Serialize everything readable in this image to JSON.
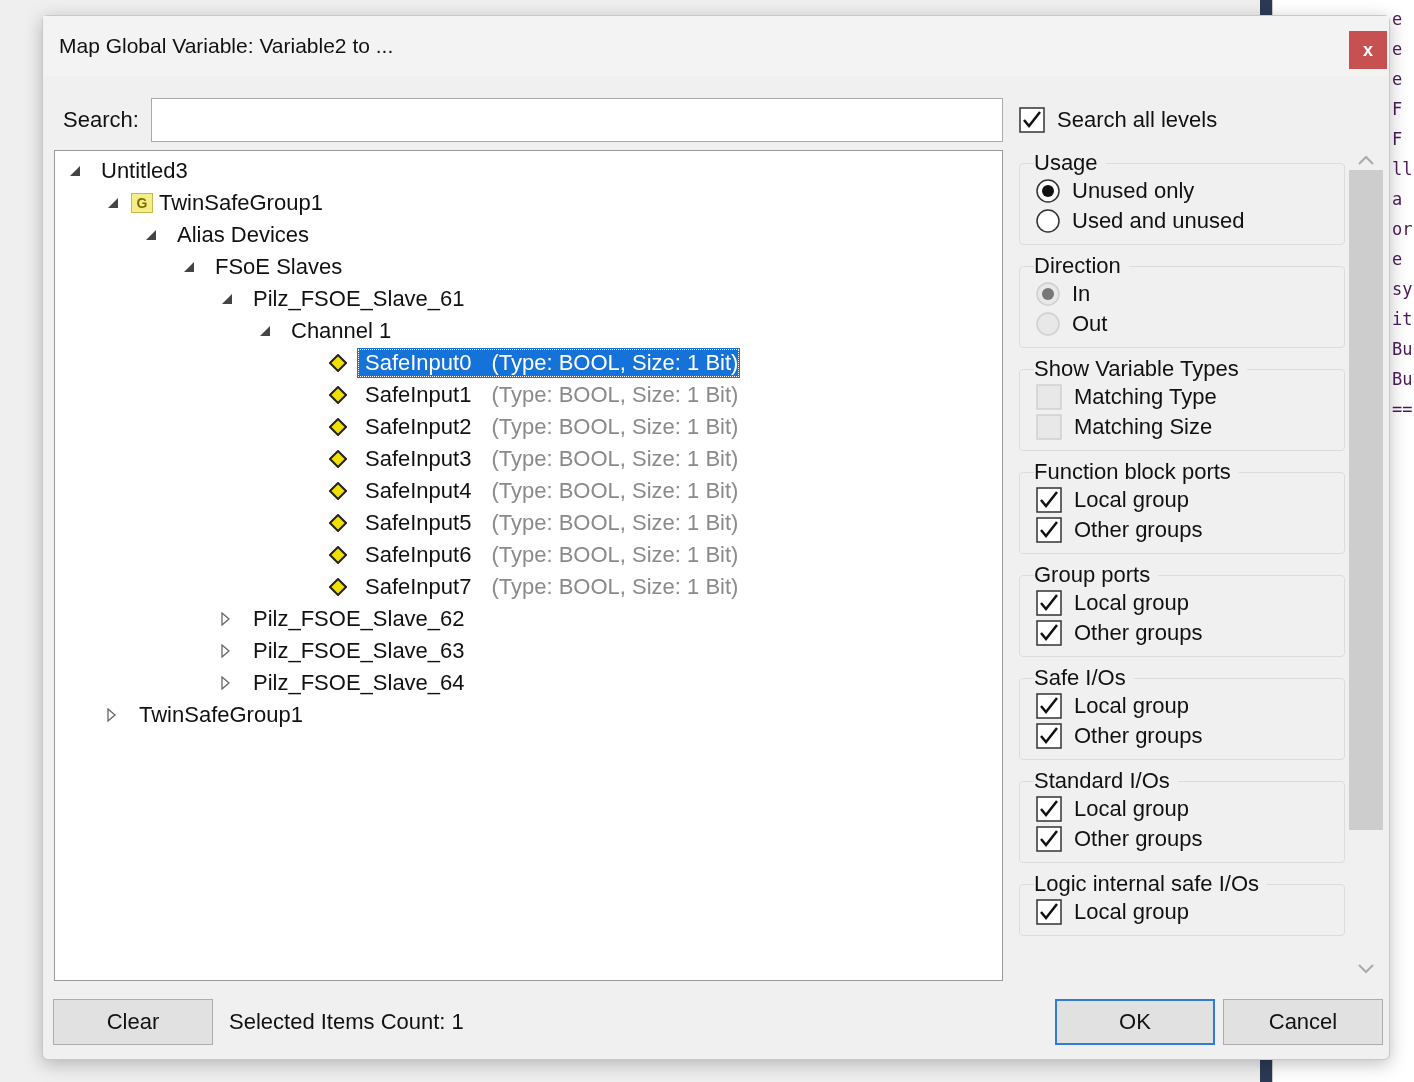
{
  "background_editor": {
    "lines": [
      "e",
      "e",
      "e",
      "F",
      "F",
      "ll",
      "a",
      "or",
      "e",
      "sy",
      "it",
      "Bu",
      "Bu",
      "=="
    ]
  },
  "dialog": {
    "title": "Map Global Variable: Variable2 to ...",
    "close_label": "x"
  },
  "search": {
    "label": "Search:"
  },
  "search_all_levels": {
    "label": "Search all levels",
    "checked": true
  },
  "tree": [
    {
      "label": "Untitled3",
      "kind": "folder",
      "expanded": true,
      "children": [
        {
          "label": "TwinSafeGroup1",
          "kind": "group",
          "badge": "G",
          "expanded": true,
          "children": [
            {
              "label": "Alias Devices",
              "kind": "folder",
              "expanded": true,
              "children": [
                {
                  "label": "FSoE Slaves",
                  "kind": "folder",
                  "expanded": true,
                  "children": [
                    {
                      "label": "Pilz_FSOE_Slave_61",
                      "kind": "folder",
                      "expanded": true,
                      "children": [
                        {
                          "label": "Channel 1",
                          "kind": "folder",
                          "expanded": true,
                          "children": [
                            {
                              "label": "SafeInput0",
                              "kind": "variable",
                              "type_info": "(Type: BOOL, Size: 1 Bit)",
                              "selected": true
                            },
                            {
                              "label": "SafeInput1",
                              "kind": "variable",
                              "type_info": "(Type: BOOL, Size: 1 Bit)",
                              "selected": false
                            },
                            {
                              "label": "SafeInput2",
                              "kind": "variable",
                              "type_info": "(Type: BOOL, Size: 1 Bit)",
                              "selected": false
                            },
                            {
                              "label": "SafeInput3",
                              "kind": "variable",
                              "type_info": "(Type: BOOL, Size: 1 Bit)",
                              "selected": false
                            },
                            {
                              "label": "SafeInput4",
                              "kind": "variable",
                              "type_info": "(Type: BOOL, Size: 1 Bit)",
                              "selected": false
                            },
                            {
                              "label": "SafeInput5",
                              "kind": "variable",
                              "type_info": "(Type: BOOL, Size: 1 Bit)",
                              "selected": false
                            },
                            {
                              "label": "SafeInput6",
                              "kind": "variable",
                              "type_info": "(Type: BOOL, Size: 1 Bit)",
                              "selected": false
                            },
                            {
                              "label": "SafeInput7",
                              "kind": "variable",
                              "type_info": "(Type: BOOL, Size: 1 Bit)",
                              "selected": false
                            }
                          ]
                        }
                      ]
                    },
                    {
                      "label": "Pilz_FSOE_Slave_62",
                      "kind": "folder",
                      "expanded": false
                    },
                    {
                      "label": "Pilz_FSOE_Slave_63",
                      "kind": "folder",
                      "expanded": false
                    },
                    {
                      "label": "Pilz_FSOE_Slave_64",
                      "kind": "folder",
                      "expanded": false
                    }
                  ]
                }
              ]
            }
          ]
        },
        {
          "label": "TwinSafeGroup1",
          "kind": "folder",
          "expanded": false
        }
      ]
    }
  ],
  "filters": [
    {
      "title": "Usage",
      "kind": "radio",
      "options": [
        {
          "label": "Unused only",
          "selected": true,
          "disabled": false
        },
        {
          "label": "Used and unused",
          "selected": false,
          "disabled": false
        }
      ]
    },
    {
      "title": "Direction",
      "kind": "radio",
      "options": [
        {
          "label": "In",
          "selected": true,
          "disabled": true
        },
        {
          "label": "Out",
          "selected": false,
          "disabled": true
        }
      ]
    },
    {
      "title": "Show Variable Types",
      "kind": "checkbox",
      "options": [
        {
          "label": "Matching Type",
          "checked": false,
          "disabled": true
        },
        {
          "label": "Matching Size",
          "checked": false,
          "disabled": true
        }
      ]
    },
    {
      "title": "Function block ports",
      "kind": "checkbox",
      "options": [
        {
          "label": "Local group",
          "checked": true,
          "disabled": false
        },
        {
          "label": "Other groups",
          "checked": true,
          "disabled": false
        }
      ]
    },
    {
      "title": "Group ports",
      "kind": "checkbox",
      "options": [
        {
          "label": "Local group",
          "checked": true,
          "disabled": false
        },
        {
          "label": "Other groups",
          "checked": true,
          "disabled": false
        }
      ]
    },
    {
      "title": "Safe I/Os",
      "kind": "checkbox",
      "options": [
        {
          "label": "Local group",
          "checked": true,
          "disabled": false
        },
        {
          "label": "Other groups",
          "checked": true,
          "disabled": false
        }
      ]
    },
    {
      "title": "Standard I/Os",
      "kind": "checkbox",
      "options": [
        {
          "label": "Local group",
          "checked": true,
          "disabled": false
        },
        {
          "label": "Other groups",
          "checked": true,
          "disabled": false
        }
      ]
    },
    {
      "title": "Logic internal safe I/Os",
      "kind": "checkbox",
      "options": [
        {
          "label": "Local group",
          "checked": true,
          "disabled": false
        }
      ]
    }
  ],
  "status": {
    "label": "Selected Items Count: 1"
  },
  "buttons": [
    {
      "label": "Clear",
      "kind": "left",
      "default": false
    },
    {
      "label": "OK",
      "kind": "right",
      "default": true
    },
    {
      "label": "Cancel",
      "kind": "right",
      "default": false
    }
  ]
}
